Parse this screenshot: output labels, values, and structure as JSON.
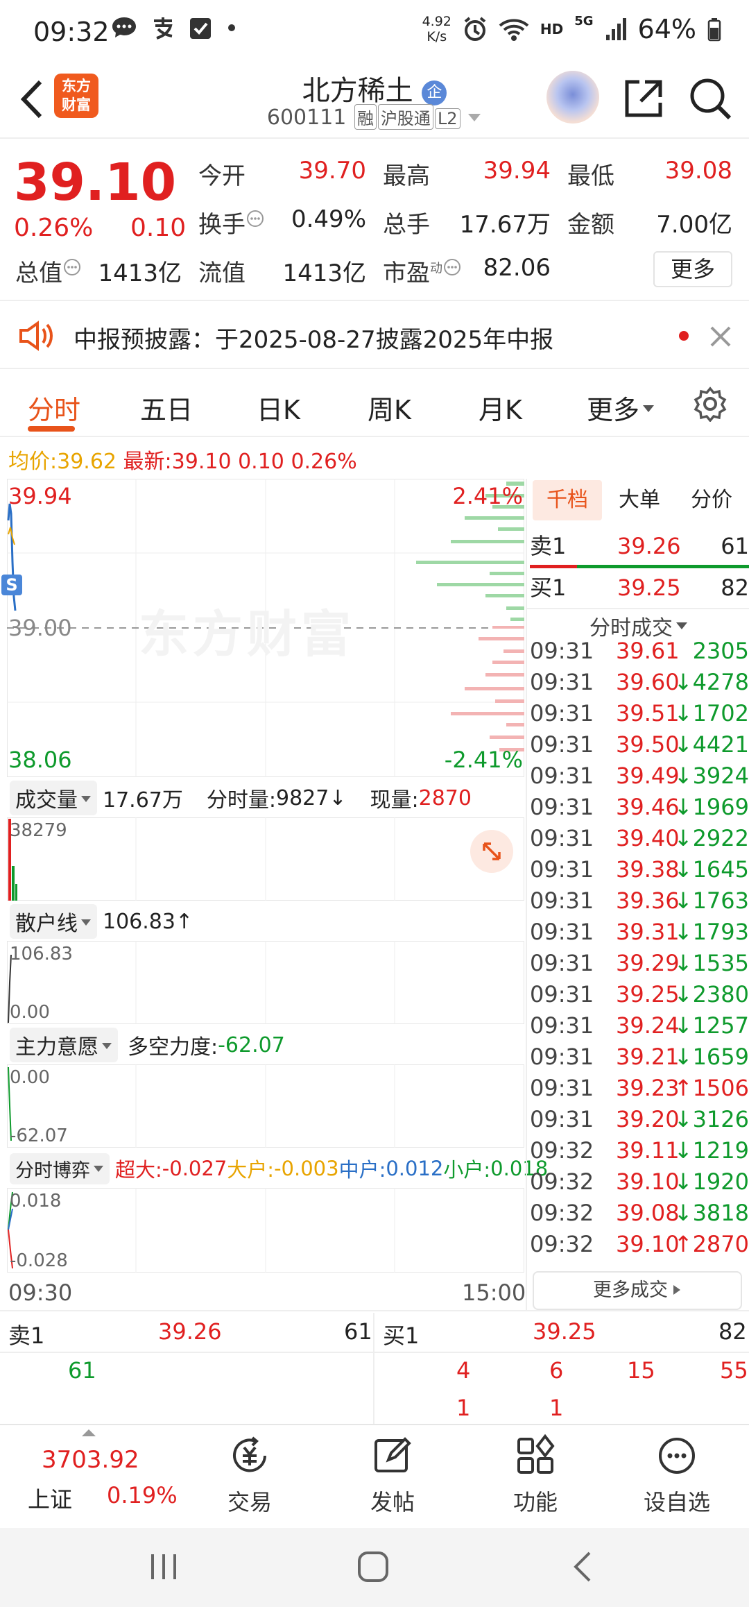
{
  "status_bar": {
    "time": "09:32",
    "net_speed_value": "4.92",
    "net_speed_unit": "K/s",
    "hd": "HD",
    "five_g": "5G",
    "battery": "64%"
  },
  "header": {
    "logo_line1": "东方",
    "logo_line2": "财富",
    "title": "北方稀土",
    "qi_badge": "企",
    "code": "600111",
    "tags": [
      "融",
      "沪股通",
      "L2"
    ]
  },
  "quote": {
    "price": "39.10",
    "change_pct": "0.26%",
    "change": "0.10",
    "open_label": "今开",
    "open": "39.70",
    "high_label": "最高",
    "high": "39.94",
    "low_label": "最低",
    "low": "39.08",
    "turnover_label": "换手",
    "turnover": "0.49%",
    "volume_label": "总手",
    "volume": "17.67万",
    "amount_label": "金额",
    "amount": "7.00亿",
    "mktcap_label": "总值",
    "mktcap": "1413亿",
    "float_label": "流值",
    "float": "1413亿",
    "pe_label": "市盈",
    "pe_sup": "动",
    "pe": "82.06",
    "more": "更多"
  },
  "notice": {
    "text": "中报预披露：于2025-08-27披露2025年中报"
  },
  "tabs": [
    "分时",
    "五日",
    "日K",
    "周K",
    "月K",
    "更多"
  ],
  "avg_line": {
    "avg_label": "均价:",
    "avg": "39.62",
    "latest_label": "最新:",
    "latest": "39.10",
    "change": "0.10",
    "pct": "0.26%"
  },
  "chart": {
    "top_price": "39.94",
    "mid_price": "39.00",
    "bottom_price": "38.06",
    "top_pct": "2.41%",
    "bottom_pct": "-2.41%",
    "watermark": "东方财富",
    "s_badge": "S",
    "start_time": "09:30",
    "end_time": "15:00"
  },
  "volume_panel": {
    "label": "成交量",
    "total": "17.67万",
    "minute_label": "分时量:",
    "minute": "9827",
    "minute_arrow": "↓",
    "now_label": "现量:",
    "now": "2870",
    "axis_max": "38279"
  },
  "retail_panel": {
    "label": "散户线",
    "value": "106.83",
    "arrow": "↑",
    "axis_max": "106.83",
    "axis_min": "0.00"
  },
  "main_panel": {
    "label": "主力意愿",
    "force_label": "多空力度:",
    "force": "-62.07",
    "axis_max": "0.00",
    "axis_min": "-62.07"
  },
  "game_panel": {
    "label": "分时博弈",
    "items": [
      {
        "name": "超大:",
        "value": "-0.027",
        "color": "#e02020"
      },
      {
        "name": "大户:",
        "value": "-0.003",
        "color": "#e8a400"
      },
      {
        "name": "中户:",
        "value": "0.012",
        "color": "#2a6fc6"
      },
      {
        "name": "小户:",
        "value": "0.018",
        "color": "#0e9a2c"
      }
    ],
    "axis_max": "0.018",
    "axis_min": "-0.028"
  },
  "right_panel": {
    "tabs": [
      "千档",
      "大单",
      "分价"
    ],
    "sell1": {
      "label": "卖1",
      "price": "39.26",
      "vol": "61"
    },
    "buy1": {
      "label": "买1",
      "price": "39.25",
      "vol": "82"
    },
    "ticks_title": "分时成交",
    "ticks": [
      {
        "time": "09:31",
        "price": "39.61",
        "arrow": "",
        "vol": "2305",
        "color": "#0e9a2c"
      },
      {
        "time": "09:31",
        "price": "39.60",
        "arrow": "↓",
        "vol": "4278",
        "color": "#0e9a2c"
      },
      {
        "time": "09:31",
        "price": "39.51",
        "arrow": "↓",
        "vol": "1702",
        "color": "#0e9a2c"
      },
      {
        "time": "09:31",
        "price": "39.50",
        "arrow": "↓",
        "vol": "4421",
        "color": "#0e9a2c"
      },
      {
        "time": "09:31",
        "price": "39.49",
        "arrow": "↓",
        "vol": "3924",
        "color": "#0e9a2c"
      },
      {
        "time": "09:31",
        "price": "39.46",
        "arrow": "↓",
        "vol": "1969",
        "color": "#0e9a2c"
      },
      {
        "time": "09:31",
        "price": "39.40",
        "arrow": "↓",
        "vol": "2922",
        "color": "#0e9a2c"
      },
      {
        "time": "09:31",
        "price": "39.38",
        "arrow": "↓",
        "vol": "1645",
        "color": "#0e9a2c"
      },
      {
        "time": "09:31",
        "price": "39.36",
        "arrow": "↓",
        "vol": "1763",
        "color": "#0e9a2c"
      },
      {
        "time": "09:31",
        "price": "39.31",
        "arrow": "↓",
        "vol": "1793",
        "color": "#0e9a2c"
      },
      {
        "time": "09:31",
        "price": "39.29",
        "arrow": "↓",
        "vol": "1535",
        "color": "#0e9a2c"
      },
      {
        "time": "09:31",
        "price": "39.25",
        "arrow": "↓",
        "vol": "2380",
        "color": "#0e9a2c"
      },
      {
        "time": "09:31",
        "price": "39.24",
        "arrow": "↓",
        "vol": "1257",
        "color": "#0e9a2c"
      },
      {
        "time": "09:31",
        "price": "39.21",
        "arrow": "↓",
        "vol": "1659",
        "color": "#0e9a2c"
      },
      {
        "time": "09:31",
        "price": "39.23",
        "arrow": "↑",
        "vol": "1506",
        "color": "#e02020"
      },
      {
        "time": "09:31",
        "price": "39.20",
        "arrow": "↓",
        "vol": "3126",
        "color": "#0e9a2c"
      },
      {
        "time": "09:32",
        "price": "39.11",
        "arrow": "↓",
        "vol": "1219",
        "color": "#0e9a2c"
      },
      {
        "time": "09:32",
        "price": "39.10",
        "arrow": "↓",
        "vol": "1920",
        "color": "#0e9a2c"
      },
      {
        "time": "09:32",
        "price": "39.08",
        "arrow": "↓",
        "vol": "3818",
        "color": "#0e9a2c"
      },
      {
        "time": "09:32",
        "price": "39.10",
        "arrow": "↑",
        "vol": "2870",
        "color": "#e02020"
      }
    ],
    "more_trades": "更多成交"
  },
  "level2": {
    "sell_label": "卖1",
    "sell_price": "39.26",
    "sell_vol": "61",
    "sell_orders": [
      "61"
    ],
    "buy_label": "买1",
    "buy_price": "39.25",
    "buy_vol": "82",
    "buy_orders_row1": [
      "4",
      "6",
      "15",
      "55"
    ],
    "buy_orders_row2": [
      "1",
      "1"
    ]
  },
  "bottom_nav": {
    "index_value": "3703.92",
    "index_name": "上证",
    "index_pct": "0.19%",
    "items": [
      "交易",
      "发帖",
      "功能",
      "设自选"
    ]
  },
  "colors": {
    "up": "#e02020",
    "down": "#0e9a2c",
    "accent": "#e8531a",
    "avg": "#e8a400"
  }
}
